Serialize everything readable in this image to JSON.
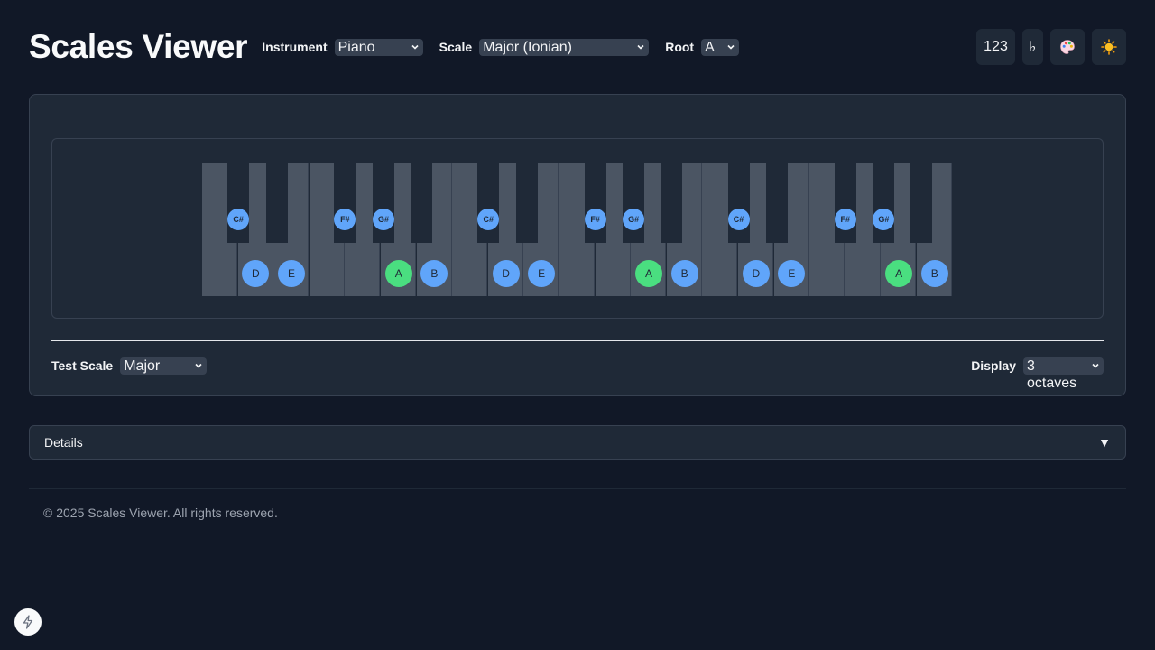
{
  "app": {
    "title": "Scales Viewer"
  },
  "controls": {
    "instrument": {
      "label": "Instrument",
      "value": "Piano"
    },
    "scale": {
      "label": "Scale",
      "value": "Major (Ionian)"
    },
    "root": {
      "label": "Root",
      "value": "A"
    }
  },
  "toolbar": {
    "numbers_label": "123",
    "flat_label": "♭",
    "palette_icon": "palette-icon",
    "theme_icon": "sun-icon"
  },
  "keyboard": {
    "octaves": 3,
    "octave_notes": {
      "white": [
        "",
        "D",
        "E",
        "",
        "",
        "A",
        "B"
      ],
      "black": [
        "C#",
        "",
        "F#",
        "G#",
        ""
      ]
    },
    "root_note": "A",
    "colors": {
      "scale_note": "#60a5fa",
      "root_note": "#4ade80",
      "white_key": "#4b5563",
      "black_key": "#1f2937"
    }
  },
  "bottom": {
    "test_scale": {
      "label": "Test Scale",
      "value": "Major"
    },
    "display": {
      "label": "Display",
      "value": "3 octaves"
    }
  },
  "details": {
    "label": "Details",
    "caret": "▼"
  },
  "footer": {
    "text": "© 2025 Scales Viewer. All rights reserved."
  },
  "bolt_icon": "bolt-icon"
}
